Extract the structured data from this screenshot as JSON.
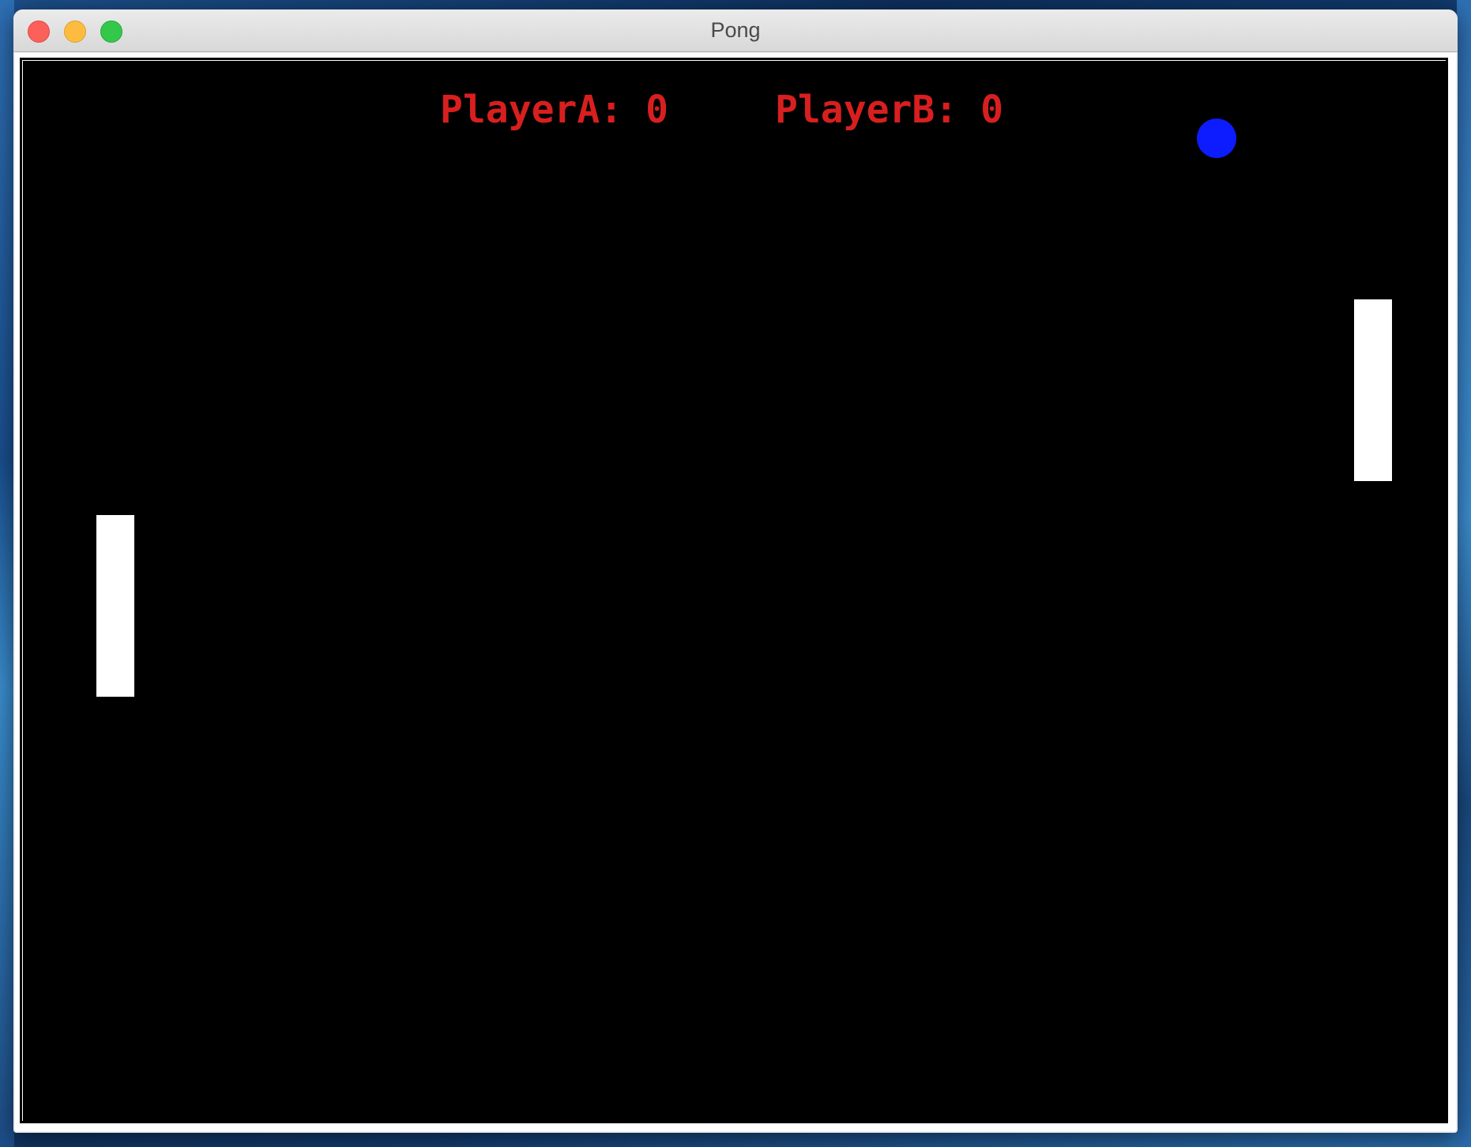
{
  "window": {
    "title": "Pong",
    "controls": {
      "close": "close-button",
      "minimize": "minimize-button",
      "maximize": "maximize-button"
    }
  },
  "game": {
    "background_color": "#000000",
    "score_color": "#d81f1f",
    "paddle_color": "#ffffff",
    "ball_color": "#0c1cff",
    "score_a_text": "PlayerA: 0",
    "score_b_text": "PlayerB: 0",
    "player_a": {
      "name": "PlayerA",
      "score": 0
    },
    "player_b": {
      "name": "PlayerB",
      "score": 0
    }
  }
}
